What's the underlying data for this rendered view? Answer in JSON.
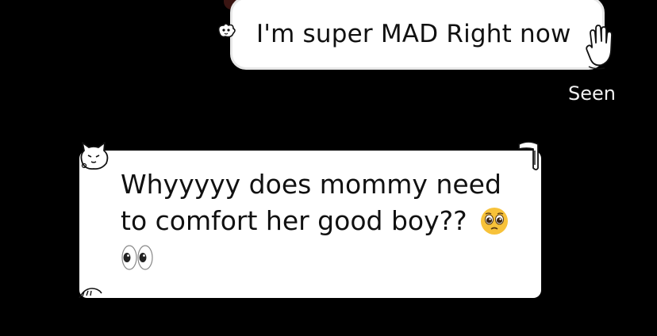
{
  "messages": {
    "sent": {
      "text": "I'm super MAD Right now",
      "status": "Seen"
    },
    "received": {
      "line1": "Whyyyyy does mommy need",
      "line2": "to comfort her good boy??"
    }
  },
  "icons": {
    "sent_decoration": "paw-doodle-icon",
    "sent_trailing": "waving-hand-doodle-icon",
    "received_emoji_1": "pleading-face-emoji",
    "received_emoji_2": "eyes-emoji",
    "received_decoration": "cat-doodle-icon"
  },
  "colors": {
    "background": "#000000",
    "bubble": "#ffffff",
    "text": "#111111",
    "status": "#f0f0f0",
    "emoji_yellow": "#f7c23a"
  }
}
